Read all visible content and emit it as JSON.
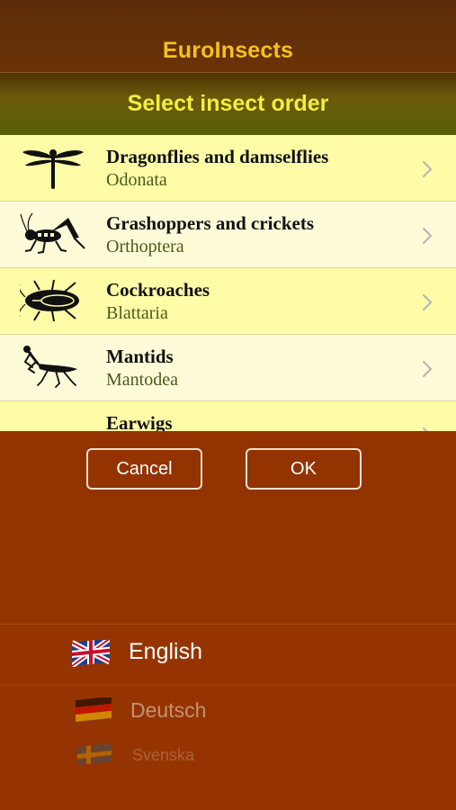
{
  "app_title": "EuroInsects",
  "picker": {
    "title": "Select insect order",
    "items": [
      {
        "name": "Dragonflies and damselflies",
        "latin": "Odonata",
        "icon": "dragonfly-icon"
      },
      {
        "name": "Grashoppers and crickets",
        "latin": "Orthoptera",
        "icon": "grasshopper-icon"
      },
      {
        "name": "Cockroaches",
        "latin": "Blattaria",
        "icon": "cockroach-icon"
      },
      {
        "name": "Mantids",
        "latin": "Mantodea",
        "icon": "mantis-icon"
      },
      {
        "name": "Earwigs",
        "latin": "",
        "icon": "earwig-icon"
      }
    ],
    "cancel_label": "Cancel",
    "ok_label": "OK"
  },
  "languages": [
    {
      "label": "English",
      "flag": "uk-flag-icon"
    },
    {
      "label": "Deutsch",
      "flag": "germany-flag-icon"
    },
    {
      "label": "Svenska",
      "flag": "sweden-flag-icon"
    }
  ],
  "colors": {
    "title": "#f2c21b",
    "picker_title": "#f3ee3c",
    "row_odd": "#fefca7",
    "row_even": "#fefbd8",
    "latin_text": "#4c5a1c",
    "background": "#923300"
  }
}
